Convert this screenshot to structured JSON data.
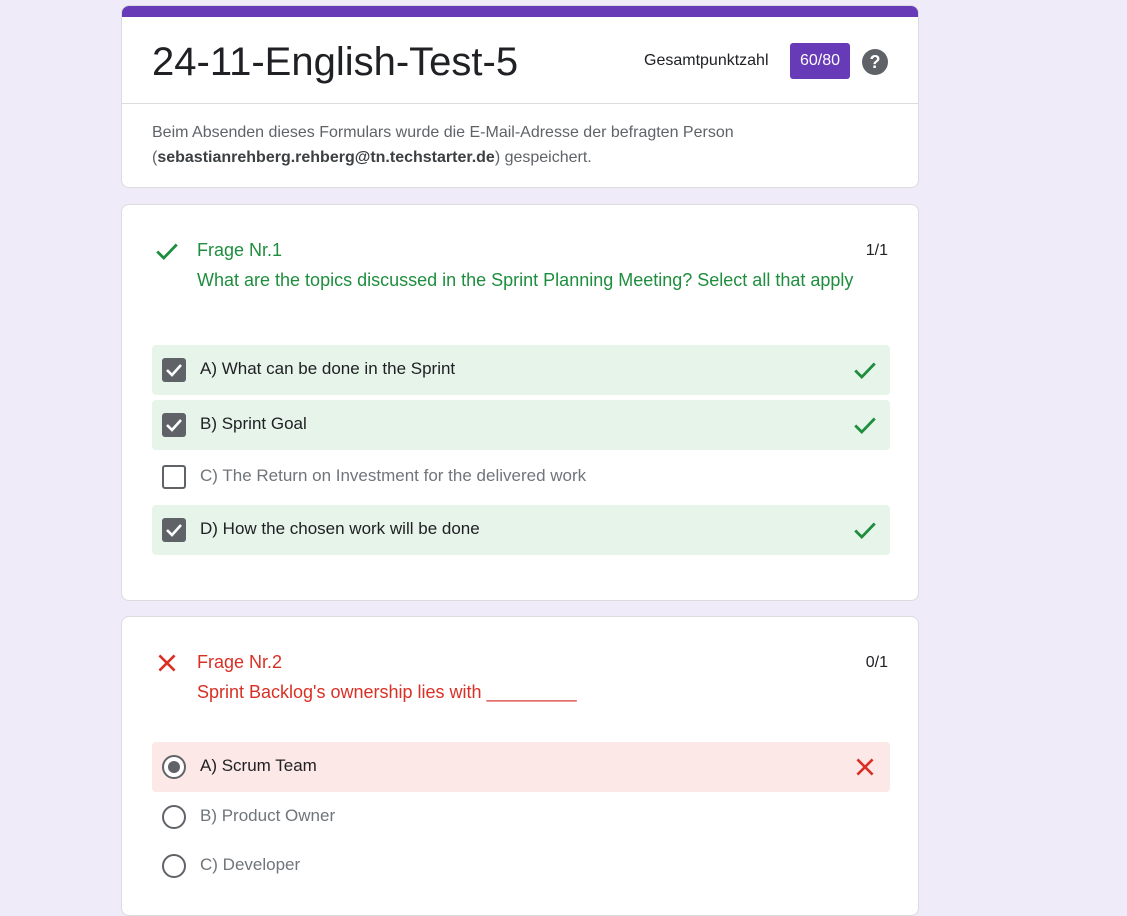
{
  "header": {
    "title": "24-11-English-Test-5",
    "score_label": "Gesamtpunktzahl",
    "score": "60/80",
    "help_symbol": "?",
    "info_prefix": "Beim Absenden dieses Formulars wurde die E-Mail-Adresse der befragten Person (",
    "info_email": "sebastianrehberg.rehberg@tn.techstarter.de",
    "info_suffix": ") gespeichert."
  },
  "colors": {
    "accent": "#673ab7",
    "background": "#f0ebf8",
    "correct": "#1e8e3e",
    "correct_bg": "#e6f4ea",
    "wrong": "#d93025",
    "wrong_bg": "#fce8e6"
  },
  "questions": [
    {
      "number": "Frage Nr.1",
      "text": "What are the topics discussed in the Sprint Planning Meeting? Select all that apply",
      "points": "1/1",
      "status_icon": "check-icon",
      "options": [
        {
          "label": "A) What can be done in the Sprint",
          "checked": true,
          "result": "correct"
        },
        {
          "label": "B) Sprint Goal",
          "checked": true,
          "result": "correct"
        },
        {
          "label": "C) The Return on Investment for the delivered work",
          "checked": false,
          "result": "none"
        },
        {
          "label": "D) How the chosen work will be done",
          "checked": true,
          "result": "correct"
        }
      ]
    },
    {
      "number": "Frage Nr.2",
      "text": "Sprint Backlog's ownership lies with _________",
      "points": "0/1",
      "status_icon": "close-icon",
      "options": [
        {
          "label": "A) Scrum Team",
          "selected": true,
          "result": "wrong"
        },
        {
          "label": "B) Product Owner",
          "selected": false,
          "result": "none"
        },
        {
          "label": "C) Developer",
          "selected": false,
          "result": "none"
        }
      ]
    }
  ]
}
